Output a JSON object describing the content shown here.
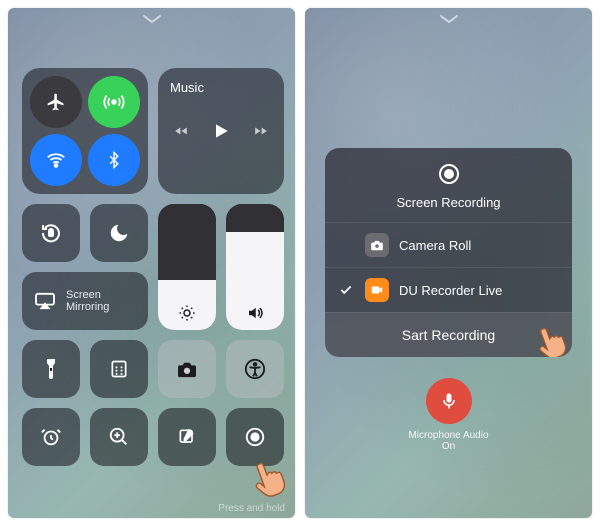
{
  "left": {
    "music_label": "Music",
    "mirror_label": "Screen\nMirroring",
    "press_hold": "Press and hold",
    "toggles": {
      "airplane": {
        "on": false,
        "bg": "#3a3a3f"
      },
      "cellular": {
        "on": true,
        "bg": "#38d159"
      },
      "wifi": {
        "on": true,
        "bg": "#1f7bff"
      },
      "bluetooth": {
        "on": true,
        "bg": "#1f7bff"
      }
    }
  },
  "right": {
    "sheet_title": "Screen Recording",
    "rows": [
      {
        "label": "Camera Roll",
        "selected": false,
        "icon_bg": "#6b6b70"
      },
      {
        "label": "DU Recorder Live",
        "selected": true,
        "icon_bg": "#ff8c1a"
      }
    ],
    "action_label": "Sart Recording",
    "mic_label": "Microphone Audio",
    "mic_state": "On"
  }
}
